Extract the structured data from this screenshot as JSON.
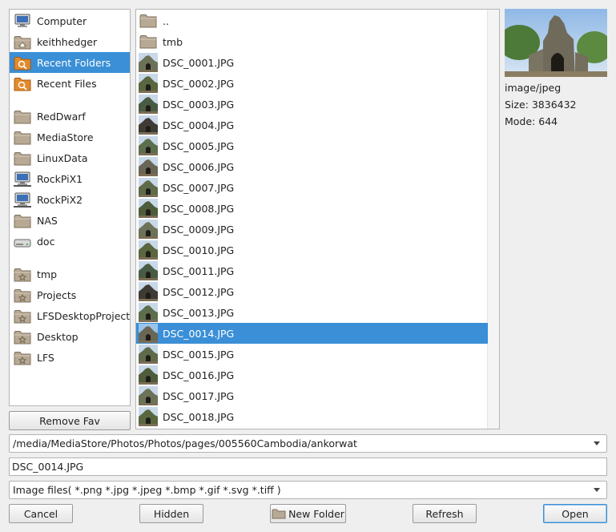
{
  "sidebar": {
    "items": [
      {
        "label": "Computer",
        "icon": "computer-icon",
        "selected": false
      },
      {
        "label": "keithhedger",
        "icon": "home-folder-icon",
        "selected": false
      },
      {
        "label": "Recent Folders",
        "icon": "recent-folders-icon",
        "selected": true
      },
      {
        "label": "Recent Files",
        "icon": "recent-files-icon",
        "selected": false
      },
      {
        "label": "RedDwarf",
        "icon": "folder-icon",
        "selected": false
      },
      {
        "label": "MediaStore",
        "icon": "folder-icon",
        "selected": false
      },
      {
        "label": "LinuxData",
        "icon": "folder-icon",
        "selected": false
      },
      {
        "label": "RockPiX1",
        "icon": "network-computer-icon",
        "selected": false
      },
      {
        "label": "RockPiX2",
        "icon": "network-computer-icon",
        "selected": false
      },
      {
        "label": "NAS",
        "icon": "folder-icon",
        "selected": false
      },
      {
        "label": "doc",
        "icon": "drive-icon",
        "selected": false
      },
      {
        "label": "tmp",
        "icon": "favourite-folder-icon",
        "selected": false
      },
      {
        "label": "Projects",
        "icon": "favourite-folder-icon",
        "selected": false
      },
      {
        "label": "LFSDesktopProject",
        "icon": "favourite-folder-icon",
        "selected": false
      },
      {
        "label": "Desktop",
        "icon": "favourite-folder-icon",
        "selected": false
      },
      {
        "label": "LFS",
        "icon": "favourite-folder-icon",
        "selected": false
      }
    ],
    "remove_fav_label": "Remove Fav"
  },
  "files": [
    {
      "name": "..",
      "type": "folder",
      "selected": false
    },
    {
      "name": "tmb",
      "type": "folder",
      "selected": false
    },
    {
      "name": "DSC_0001.JPG",
      "type": "image",
      "selected": false
    },
    {
      "name": "DSC_0002.JPG",
      "type": "image",
      "selected": false
    },
    {
      "name": "DSC_0003.JPG",
      "type": "image",
      "selected": false
    },
    {
      "name": "DSC_0004.JPG",
      "type": "image",
      "selected": false
    },
    {
      "name": "DSC_0005.JPG",
      "type": "image",
      "selected": false
    },
    {
      "name": "DSC_0006.JPG",
      "type": "image",
      "selected": false
    },
    {
      "name": "DSC_0007.JPG",
      "type": "image",
      "selected": false
    },
    {
      "name": "DSC_0008.JPG",
      "type": "image",
      "selected": false
    },
    {
      "name": "DSC_0009.JPG",
      "type": "image",
      "selected": false
    },
    {
      "name": "DSC_0010.JPG",
      "type": "image",
      "selected": false
    },
    {
      "name": "DSC_0011.JPG",
      "type": "image",
      "selected": false
    },
    {
      "name": "DSC_0012.JPG",
      "type": "image",
      "selected": false
    },
    {
      "name": "DSC_0013.JPG",
      "type": "image",
      "selected": false
    },
    {
      "name": "DSC_0014.JPG",
      "type": "image",
      "selected": true
    },
    {
      "name": "DSC_0015.JPG",
      "type": "image",
      "selected": false
    },
    {
      "name": "DSC_0016.JPG",
      "type": "image",
      "selected": false
    },
    {
      "name": "DSC_0017.JPG",
      "type": "image",
      "selected": false
    },
    {
      "name": "DSC_0018.JPG",
      "type": "image",
      "selected": false
    }
  ],
  "preview": {
    "mime": "image/jpeg",
    "size": "Size: 3836432",
    "mode": "Mode: 644"
  },
  "path": "/media/MediaStore/Photos/Photos/pages/005560Cambodia/ankorwat",
  "filename": "DSC_0014.JPG",
  "filter": "Image files(  *.png *.jpg *.jpeg *.bmp *.gif *.svg *.tiff )",
  "buttons": {
    "cancel": "Cancel",
    "hidden": "Hidden",
    "new_folder": "New Folder",
    "refresh": "Refresh",
    "open": "Open"
  },
  "colors": {
    "selection": "#3a8fd6",
    "folder": "#b7a994",
    "recent": "#e38b2b"
  }
}
